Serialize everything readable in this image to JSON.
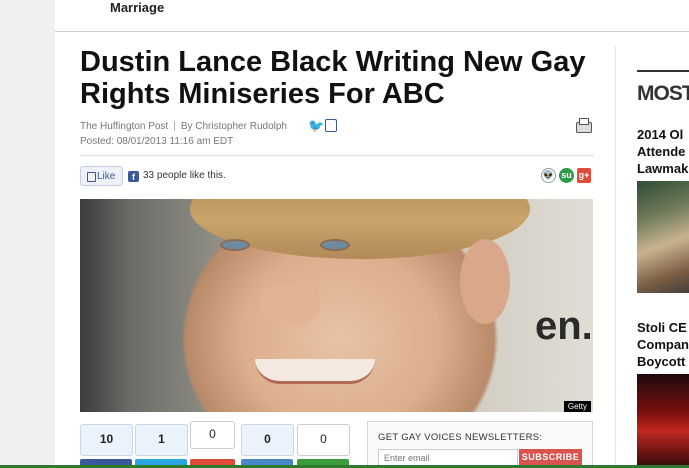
{
  "nav": {
    "items": [
      "Marriage"
    ]
  },
  "article": {
    "headline": "Dustin Lance Black Writing New Gay Rights Miniseries For ABC",
    "source": "The Huffington Post",
    "by": "By Christopher Rudolph",
    "posted": "Posted: 08/01/2013 11:16 am EDT",
    "photo_credit": "Getty"
  },
  "facebook": {
    "like_label": "Like",
    "count_text": "33 people like this."
  },
  "share_counts": [
    "10",
    "1",
    "0",
    "0",
    "0"
  ],
  "newsletter": {
    "title": "GET GAY VOICES NEWSLETTERS:",
    "placeholder": "Enter email",
    "button": "SUBSCRIBE"
  },
  "sidebar": {
    "heading": "MOST",
    "stories": [
      "2014 Ol Attende Lawmak",
      "Stoli CE Compan Boycott"
    ]
  },
  "colors": {
    "share_bar": [
      "#3b5998",
      "#29a5e0",
      "#dd4b39",
      "#4a87c7",
      "#3a9c3a"
    ],
    "newsletter_button": "#d9534f"
  },
  "icons": [
    "twitter-icon",
    "facebook-like-icon",
    "print-icon",
    "reddit-icon",
    "stumbleupon-icon",
    "google-plus-icon"
  ]
}
